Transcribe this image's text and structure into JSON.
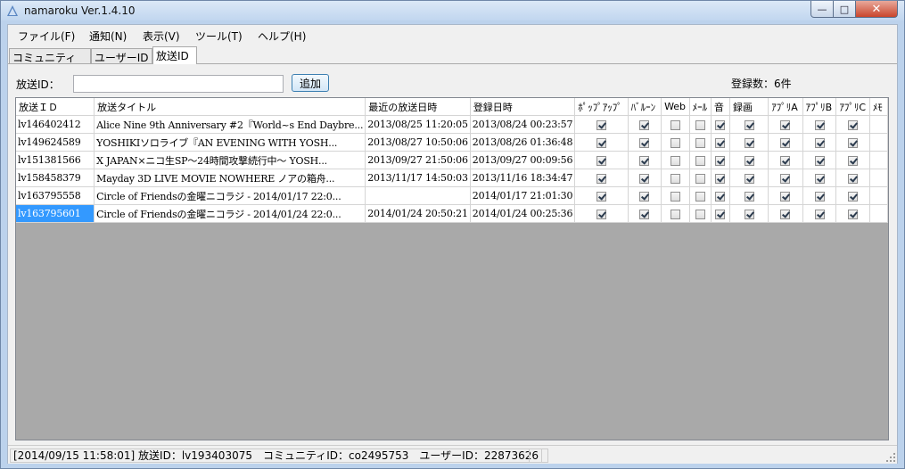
{
  "window": {
    "title": "namaroku Ver.1.4.10",
    "controls": {
      "minimize": "—",
      "maximize": "□",
      "close": "✕"
    }
  },
  "menu": [
    "ファイル(F)",
    "通知(N)",
    "表示(V)",
    "ツール(T)",
    "ヘルプ(H)"
  ],
  "tabs": [
    "コミュニティID",
    "ユーザーID",
    "放送ID"
  ],
  "active_tab": "放送ID",
  "form": {
    "id_label": "放送ID：",
    "id_value": "",
    "add_button": "追加",
    "count_label": "登録数：6件"
  },
  "table": {
    "columns": [
      "放送ＩＤ",
      "放送タイトル",
      "最近の放送日時",
      "登録日時",
      "ﾎﾟｯﾌﾟｱｯﾌﾟ",
      "ﾊﾞﾙｰﾝ",
      "Web",
      "ﾒｰﾙ",
      "音",
      "録画",
      "ｱﾌﾟﾘA",
      "ｱﾌﾟﾘB",
      "ｱﾌﾟﾘC",
      "ﾒﾓ"
    ],
    "rows": [
      {
        "id": "lv146402412",
        "title": "Alice Nine 9th Anniversary #2『World~s End Daybre...",
        "last_broadcast": "2013/08/25 11:20:05",
        "registered": "2013/08/24 00:23:57",
        "checks": [
          true,
          true,
          false,
          false,
          true,
          true,
          true,
          true,
          true
        ]
      },
      {
        "id": "lv149624589",
        "title": "YOSHIKIソロライブ『AN EVENING WITH YOSH...",
        "last_broadcast": "2013/08/27 10:50:06",
        "registered": "2013/08/26 01:36:48",
        "checks": [
          true,
          true,
          false,
          false,
          true,
          true,
          true,
          true,
          true
        ]
      },
      {
        "id": "lv151381566",
        "title": "X JAPAN×ニコ生SP～24時間攻撃続行中～ YOSH...",
        "last_broadcast": "2013/09/27 21:50:06",
        "registered": "2013/09/27 00:09:56",
        "checks": [
          true,
          true,
          false,
          false,
          true,
          true,
          true,
          true,
          true
        ]
      },
      {
        "id": "lv158458379",
        "title": "Mayday 3D LIVE MOVIE NOWHERE ノアの箱舟...",
        "last_broadcast": "2013/11/17 14:50:03",
        "registered": "2013/11/16 18:34:47",
        "checks": [
          true,
          true,
          false,
          false,
          true,
          true,
          true,
          true,
          true
        ]
      },
      {
        "id": "lv163795558",
        "title": "Circle of Friendsの金曜ニコラジ - 2014/01/17 22:0...",
        "last_broadcast": "",
        "registered": "2014/01/17 21:01:30",
        "checks": [
          true,
          true,
          false,
          false,
          true,
          true,
          true,
          true,
          true
        ]
      },
      {
        "id": "lv163795601",
        "title": "Circle of Friendsの金曜ニコラジ - 2014/01/24 22:0...",
        "last_broadcast": "2014/01/24 20:50:21",
        "registered": "2014/01/24 00:25:36",
        "checks": [
          true,
          true,
          false,
          false,
          true,
          true,
          true,
          true,
          true
        ],
        "selected": true
      }
    ]
  },
  "status": {
    "text": "[2014/09/15 11:58:01]  放送ID：lv193403075　コミュニティID：co2495753　ユーザーID：22873626"
  }
}
